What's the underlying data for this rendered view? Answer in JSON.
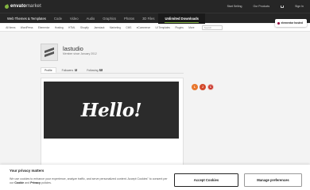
{
  "header": {
    "logo_brand": "envato",
    "logo_suffix": "market",
    "links": [
      "Start Selling",
      "Our Products",
      "Sign In"
    ]
  },
  "categories": [
    {
      "label": "Web Themes & Templates",
      "active": true
    },
    {
      "label": "Code",
      "active": false
    },
    {
      "label": "Video",
      "active": false
    },
    {
      "label": "Audio",
      "active": false
    },
    {
      "label": "Graphics",
      "active": false
    },
    {
      "label": "Photos",
      "active": false
    },
    {
      "label": "3D Files",
      "active": false
    }
  ],
  "unlimited_label": "Unlimited Downloads",
  "subnav": {
    "items": [
      "All Items",
      "WordPress",
      "Elementor",
      "Hosting",
      "HTML",
      "Shopify",
      "Jamstack",
      "Marketing",
      "CMS",
      "eCommerce",
      "UI Templates",
      "Plugins",
      "More"
    ],
    "search_placeholder": "Search"
  },
  "promo_badge": "elementor hosted",
  "profile": {
    "username": "lastudio",
    "member_since": "Member since January 2012"
  },
  "tabs": [
    {
      "label": "Profile",
      "count": "",
      "active": true
    },
    {
      "label": "Followers",
      "count": "5",
      "active": false
    },
    {
      "label": "Following",
      "count": "0",
      "active": false
    }
  ],
  "banner_text": "Hello!",
  "user_badges": [
    "L",
    "J",
    "C"
  ],
  "colors": {
    "brand_green": "#82b440",
    "topbar": "#262626",
    "badge_orange": "#e8772e",
    "badge_red": "#c8352c"
  },
  "cookie": {
    "title": "Your privacy matters",
    "body_prefix": "We use cookies to enhance your experience, analyze traffic, and serve personalized content. Accept Cookies\" to consent per our ",
    "cookies_link": "Cookie",
    "body_middle": " and ",
    "privacy_link": "Privacy",
    "body_suffix": " policies.",
    "accept_label": "Accept Cookies",
    "prefs_label": "Manage preferences"
  }
}
